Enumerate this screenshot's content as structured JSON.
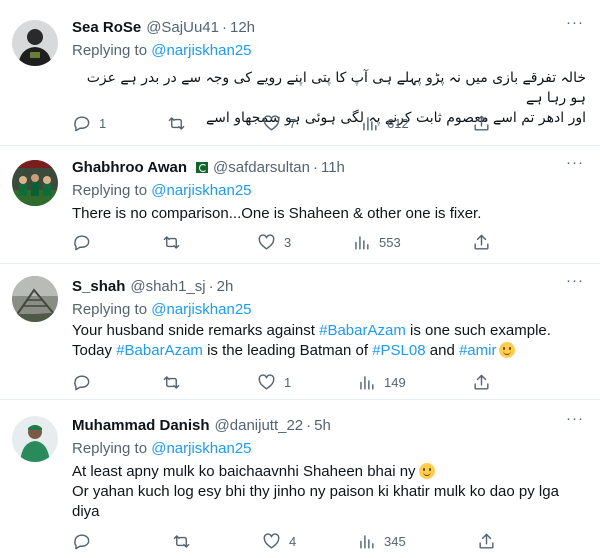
{
  "tweets": [
    {
      "name": "Sea RoSe",
      "handle": "@SajUu41",
      "time": "12h",
      "replying_prefix": "Replying to ",
      "replying_to": "@narjiskhan25",
      "text_line1": "خالہ تفرقے بازی میں نہ پڑو پہلے ہی آپ کا پتی اپنے رویے کی وجہ سے در بدر ہے عزت ہو رہا ہے",
      "text_line2": "اور ادھر تم اسے معصوم ثابت کرنے پہ لگی ہوئی ہو سمجھاو اسے",
      "replies": "1",
      "retweets": "",
      "likes": "7",
      "views": "612"
    },
    {
      "name": "Ghabhroo Awan",
      "flag": "pakistan-flag-emoji",
      "handle": "@safdarsultan",
      "time": "11h",
      "replying_prefix": "Replying to ",
      "replying_to": "@narjiskhan25",
      "text": "There is no comparison...One is Shaheen & other one is fixer.",
      "replies": "",
      "retweets": "",
      "likes": "3",
      "views": "553"
    },
    {
      "name": "S_shah",
      "handle": "@shah1_sj",
      "time": "2h",
      "replying_prefix": "Replying to ",
      "replying_to": "@narjiskhan25",
      "line1_a": "Your husband snide remarks against ",
      "line1_tag": "#BabarAzam",
      "line1_b": " is one such example.",
      "line2_a": "Today ",
      "line2_tag1": "#BabarAzam",
      "line2_b": " is the leading Batman of ",
      "line2_tag2": "#PSL08",
      "line2_c": " and ",
      "line2_tag3": "#amir",
      "replies": "",
      "retweets": "",
      "likes": "1",
      "views": "149"
    },
    {
      "name": "Muhammad Danish",
      "handle": "@danijutt_22",
      "time": "5h",
      "replying_prefix": "Replying to ",
      "replying_to": "@narjiskhan25",
      "line1": "At least apny mulk ko baichaavnhi Shaheen bhai ny",
      "line2": "Or yahan kuch log esy bhi thy jinho ny paison ki khatir mulk ko dao py lga",
      "line3": "diya",
      "replies": "",
      "retweets": "",
      "likes": "4",
      "views": "345"
    }
  ],
  "dot": "·",
  "more_glyph": "···",
  "icon_names": [
    "reply-icon",
    "retweet-icon",
    "like-icon",
    "views-icon",
    "share-icon",
    "more-icon"
  ],
  "colors": {
    "link": "#1d9bf0",
    "secondary": "#536471",
    "text": "#0f1419",
    "divider": "#e6ecf0"
  }
}
